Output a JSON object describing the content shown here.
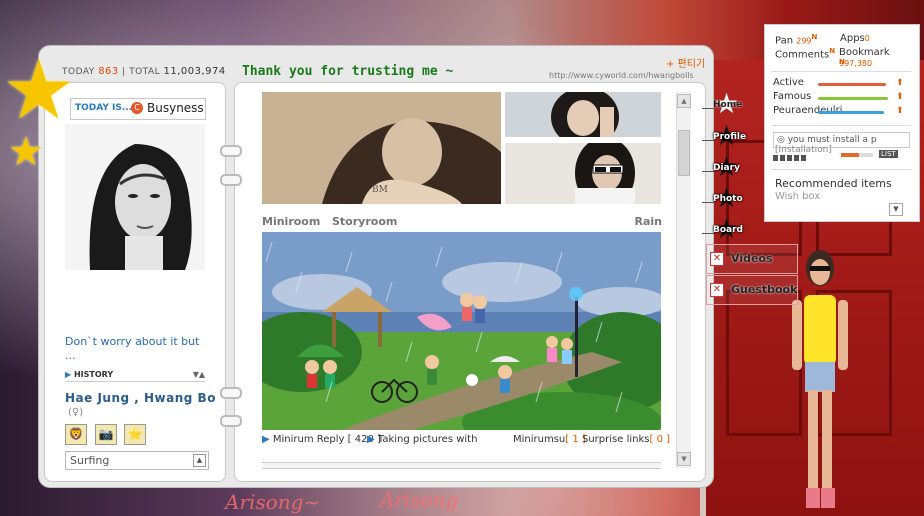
{
  "counter": {
    "today_label": "TODAY",
    "today_value": "863",
    "separator": "|",
    "total_label": "TOTAL",
    "total_value": "11,003,974"
  },
  "header": {
    "title": "Thank you for trusting me ~",
    "edit_link": "+ 편티기",
    "url": "http://www.cyworld.com/hwangbolls"
  },
  "left_panel": {
    "today_is_label": "TODAY IS...",
    "today_is_icon": "C",
    "today_is_value": "Busyness",
    "message": "Don`t worry about it but ...",
    "history_label": "HISTORY",
    "history_arrows": "▼▲",
    "name": "Hae Jung , Hwang Bo",
    "gender_symbol": "(♀)",
    "icons": [
      "lion-icon",
      "camera-icon",
      "star-icon"
    ],
    "surfing_value": "Surfing",
    "surfing_arrow": "▲"
  },
  "main": {
    "tabs": [
      "Miniroom",
      "Storyroom"
    ],
    "weather": "Rain",
    "info": {
      "reply_label": "Minirum Reply",
      "reply_count": "[ 420 ]",
      "pictures_label": "Taking pictures with",
      "minirumsu_label": "Minirumsu",
      "minirumsu_count": "[ 1 ]",
      "surprise_label": "Surprise links",
      "surprise_count": "[ 0 ]"
    },
    "scroll_up": "▲",
    "scroll_down": "▼"
  },
  "menu": {
    "items": [
      "Home",
      "Profile",
      "Diary",
      "Photo",
      "Board"
    ],
    "extra": [
      "Videos",
      "Guestbook"
    ],
    "extra_close": "✕"
  },
  "popup": {
    "pan_label": "Pan",
    "pan_value": "299",
    "apps_label": "Apps",
    "apps_value": "0",
    "comments_label": "Comments",
    "bookmark_label": "Bookmark",
    "bookmark_value": "997,380",
    "new_mark": "N",
    "stats": [
      {
        "label": "Active",
        "color": "#e0603a"
      },
      {
        "label": "Famous",
        "color": "#8ac43a"
      },
      {
        "label": "Peuraendeulri",
        "color": "#3aa0d8"
      }
    ],
    "stat_arrow": "⬆",
    "install_text": "you must install a p",
    "installation_text": "[Installation]",
    "player_list": "LIST",
    "reco_title": "Recommended items",
    "wishbox": "Wish box",
    "reco_arrow": "▼"
  },
  "background": {
    "bottom_text_1": "Arisong~",
    "bottom_text_2": "Arisong"
  }
}
